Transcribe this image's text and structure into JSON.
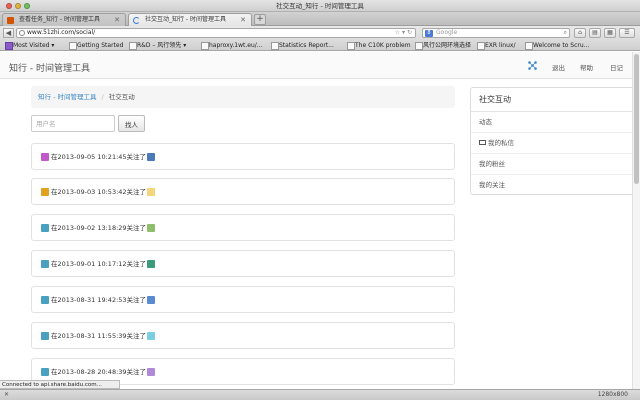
{
  "window": {
    "title": "社交互动_知行 - 时间管理工具"
  },
  "tabs": [
    {
      "label": "查看任务_知行 - 时间管理工具",
      "active": false
    },
    {
      "label": "社交互动_知行 - 时间管理工具",
      "active": true
    }
  ],
  "newtab_label": "+",
  "address": {
    "url": "www.51zhi.com/social/",
    "search_placeholder": "Google"
  },
  "bookmarks": [
    "Most Visited ▾",
    "Getting Started",
    "R&D – 风行领先 ▾",
    "haproxy.1wt.eu/...",
    "Statistics Report...",
    "The C10K problem",
    "风行公网环境选择",
    "EXR linux/",
    "Welcome to Scru..."
  ],
  "site": {
    "brand": "知行 - 时间管理工具",
    "nav": {
      "logout": "退出",
      "help": "帮助",
      "diary": "日记"
    }
  },
  "breadcrumb": {
    "home": "知行 - 时间管理工具",
    "separator": "/",
    "current": "社交互动"
  },
  "search": {
    "placeholder": "用户名",
    "button": "找人"
  },
  "feed": [
    {
      "text": "在2013-09-05 10:21:45关注了",
      "c1": "#c05ac8",
      "c2": "#4a7ab8"
    },
    {
      "text": "在2013-09-03 10:53:42关注了",
      "c1": "#e0a020",
      "c2": "#f3d57a"
    },
    {
      "text": "在2013-09-02 13:18:29关注了",
      "c1": "#4aa0c0",
      "c2": "#8fbf6a"
    },
    {
      "text": "在2013-09-01 10:17:12关注了",
      "c1": "#4aa0c0",
      "c2": "#3a9a7a"
    },
    {
      "text": "在2013-08-31 19:42:53关注了",
      "c1": "#4aa0c0",
      "c2": "#5a8ad0"
    },
    {
      "text": "在2013-08-31 11:55:39关注了",
      "c1": "#4aa0c0",
      "c2": "#7ad0e0"
    },
    {
      "text": "在2013-08-28 20:48:39关注了",
      "c1": "#4aa0c0",
      "c2": "#b08ad8"
    }
  ],
  "sidebar": {
    "title": "社交互动",
    "items": [
      "动态",
      "我的私信",
      "我的粉丝",
      "我的关注"
    ]
  },
  "status": {
    "connecting": "Connected to api.share.baidu.com...",
    "close": "✕",
    "resolution": "1280x800"
  }
}
